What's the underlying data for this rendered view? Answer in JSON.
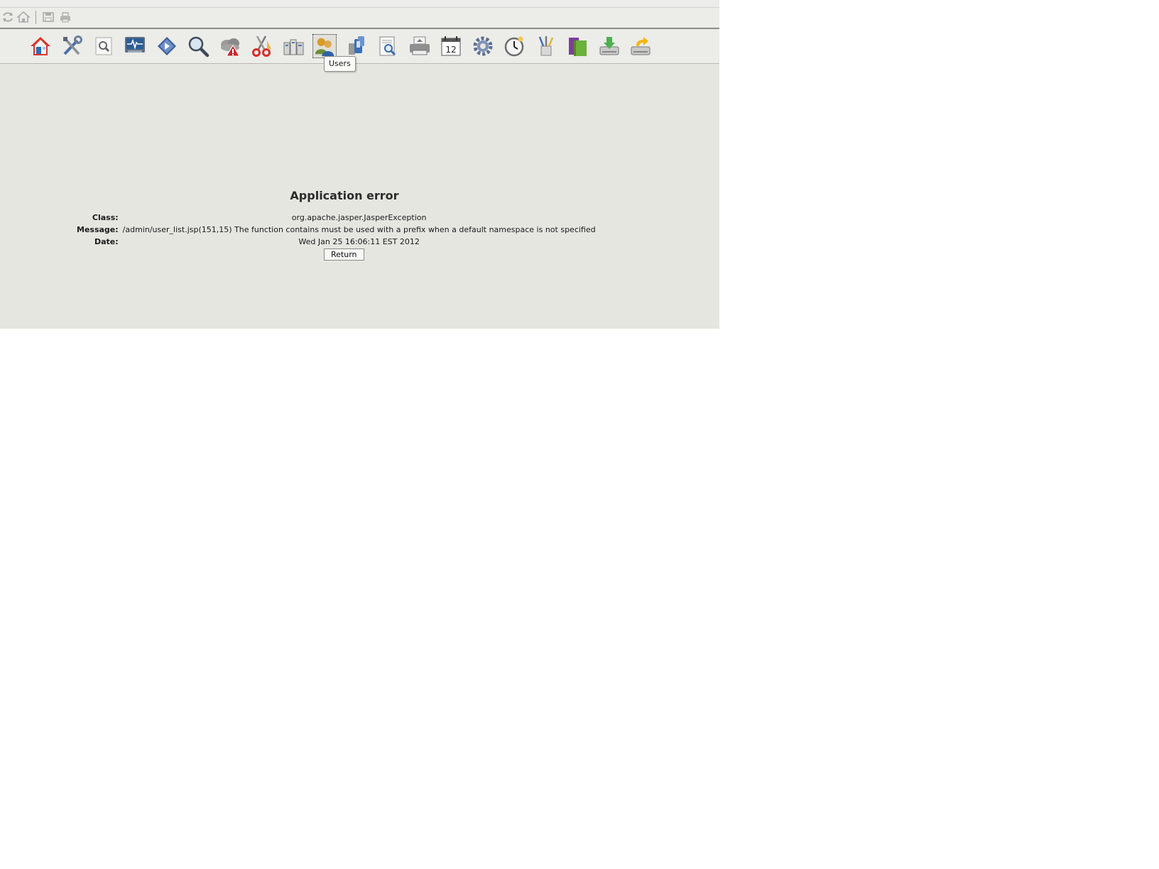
{
  "minibar": {
    "icons": [
      "refresh-icon",
      "home-icon",
      "save-icon",
      "print-icon"
    ]
  },
  "toolbar": {
    "buttons": [
      {
        "icon": "home-icon"
      },
      {
        "icon": "tools-icon"
      },
      {
        "icon": "search-document-icon"
      },
      {
        "icon": "monitor-icon"
      },
      {
        "icon": "diamond-arrow-icon"
      },
      {
        "icon": "magnifier-icon"
      },
      {
        "icon": "cloud-warning-icon"
      },
      {
        "icon": "scissors-icon"
      },
      {
        "icon": "servers-icon"
      },
      {
        "icon": "users-icon",
        "tooltip": "Users",
        "active": true
      },
      {
        "icon": "devices-icon"
      },
      {
        "icon": "document-preview-icon"
      },
      {
        "icon": "printer-icon"
      },
      {
        "icon": "calendar-icon",
        "text": "12"
      },
      {
        "icon": "gear-icon"
      },
      {
        "icon": "clock-icon"
      },
      {
        "icon": "pens-icon"
      },
      {
        "icon": "books-icon"
      },
      {
        "icon": "drive-download-icon"
      },
      {
        "icon": "drive-upload-icon"
      }
    ]
  },
  "tooltip": {
    "text": "Users"
  },
  "error": {
    "title": "Application error",
    "class_label": "Class:",
    "class_value": "org.apache.jasper.JasperException",
    "message_label": "Message:",
    "message_value": "/admin/user_list.jsp(151,15) The function contains must be used with a prefix when a default namespace is not specified",
    "date_label": "Date:",
    "date_value": "Wed Jan 25 16:06:11 EST 2012",
    "return_label": "Return"
  },
  "colors": {
    "page_background": "#e6e6e1",
    "toolbar_background": "#ecece8",
    "home_red": "#d9342b",
    "folder_green": "#6ab23a"
  }
}
